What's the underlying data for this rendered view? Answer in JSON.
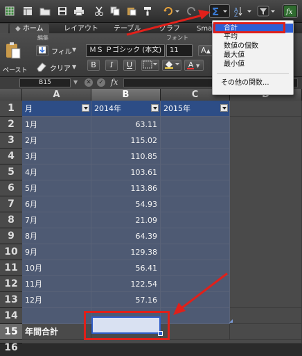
{
  "toolbar": {
    "icons": [
      "grid-icon",
      "template-icon",
      "open-folder-icon",
      "save-icon",
      "print-icon",
      "cut-icon",
      "copy-icon",
      "paste-icon",
      "format-brush-icon",
      "undo-icon",
      "redo-icon",
      "autosum-icon",
      "sort-icon",
      "filter-icon",
      "formula-builder-icon"
    ]
  },
  "ribbon_tabs": [
    "ホーム",
    "レイアウト",
    "テーブル",
    "グラフ",
    "Smar"
  ],
  "ribbon": {
    "group_edit": "編集",
    "group_font": "フォント",
    "fill_label": "フィル",
    "clear_label": "クリア",
    "paste_label": "ペースト",
    "font_name": "ＭＳ Ｐゴシック (本文)",
    "font_size": "11",
    "bold": "B",
    "italic": "I",
    "underline": "U",
    "grow_font": "A",
    "font_color_label": "A"
  },
  "formula_bar": {
    "name_box": "B15",
    "fx": "fx"
  },
  "columns": [
    "A",
    "B",
    "C",
    "D"
  ],
  "rows": [
    "1",
    "2",
    "3",
    "4",
    "5",
    "6",
    "7",
    "8",
    "9",
    "10",
    "11",
    "12",
    "13",
    "14",
    "15",
    "16"
  ],
  "table": {
    "headers": [
      "月",
      "2014年",
      "2015年"
    ],
    "data": [
      {
        "month": "1月",
        "v2014": "63.11",
        "v2015": ""
      },
      {
        "month": "2月",
        "v2014": "115.02",
        "v2015": ""
      },
      {
        "month": "3月",
        "v2014": "110.85",
        "v2015": ""
      },
      {
        "month": "4月",
        "v2014": "103.61",
        "v2015": ""
      },
      {
        "month": "5月",
        "v2014": "113.86",
        "v2015": ""
      },
      {
        "month": "6月",
        "v2014": "54.93",
        "v2015": ""
      },
      {
        "month": "7月",
        "v2014": "21.09",
        "v2015": ""
      },
      {
        "month": "8月",
        "v2014": "64.39",
        "v2015": ""
      },
      {
        "month": "9月",
        "v2014": "129.38",
        "v2015": ""
      },
      {
        "month": "10月",
        "v2014": "56.41",
        "v2015": ""
      },
      {
        "month": "11月",
        "v2014": "122.54",
        "v2015": ""
      },
      {
        "month": "12月",
        "v2014": "57.16",
        "v2015": ""
      }
    ],
    "total_label": "年間合計"
  },
  "autosum_menu": {
    "items": [
      "合計",
      "平均",
      "数値の個数",
      "最大値",
      "最小値"
    ],
    "more": "その他の関数...",
    "highlighted": "合計"
  },
  "colors": {
    "header_fill": "#2d4d86",
    "band_fill": "#4e5a73",
    "highlight": "#2d5fd6",
    "annotation_red": "#e0201a"
  }
}
